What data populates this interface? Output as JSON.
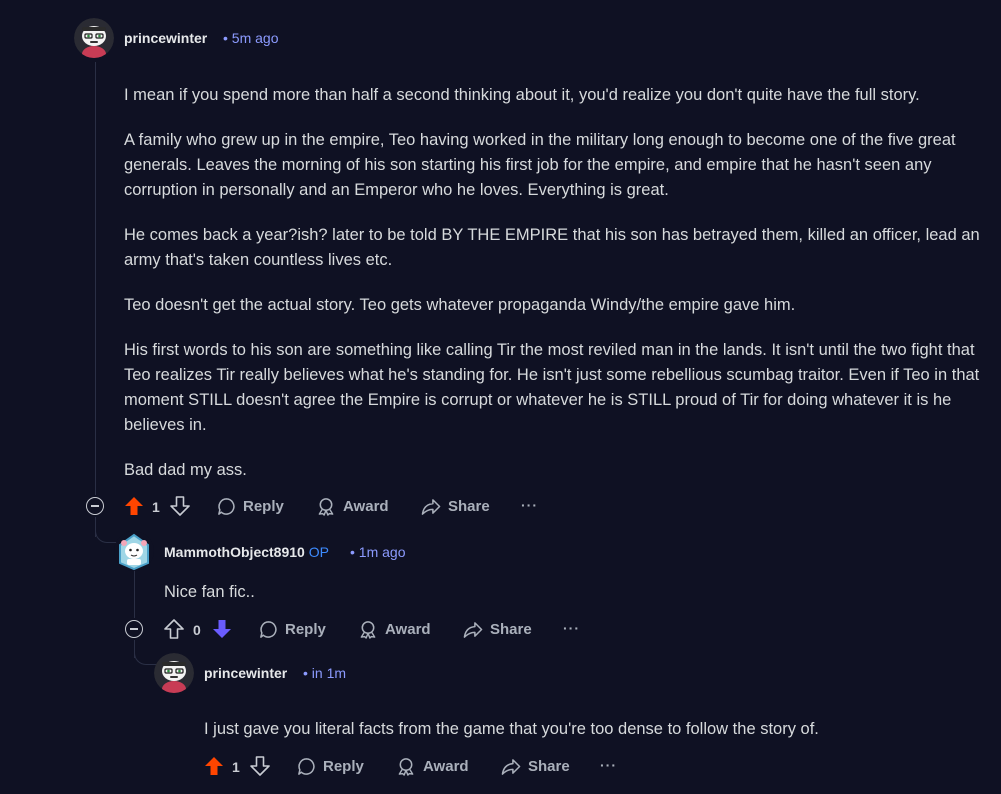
{
  "comments": [
    {
      "username": "princewinter",
      "meta": "• 5m ago",
      "paragraphs": [
        "I mean if you spend more than half a second thinking about it, you'd realize you don't quite have the full story.",
        "A family who grew up in the empire, Teo having worked in the military long enough to become one of the five great generals. Leaves the morning of his son starting his first job for the empire, and empire that he hasn't seen any corruption in personally and an Emperor who he loves. Everything is great.",
        "He comes back a year?ish? later to be told BY THE EMPIRE that his son has betrayed them, killed an officer, lead an army that's taken countless lives etc.",
        "Teo doesn't get the actual story. Teo gets whatever propaganda Windy/the empire gave him.",
        "His first words to his son are something like calling Tir the most reviled man in the lands. It isn't until the two fight that Teo realizes Tir really believes what he's standing for. He isn't just some rebellious scumbag traitor. Even if Teo in that moment STILL doesn't agree the Empire is corrupt or whatever he is STILL proud of Tir for doing whatever it is he believes in.",
        "Bad dad my ass."
      ],
      "score": "1",
      "vote": "up",
      "actions": {
        "reply": "Reply",
        "award": "Award",
        "share": "Share",
        "more": "···"
      }
    },
    {
      "username": "MammothObject8910",
      "op_badge": "OP",
      "meta": "• 1m ago",
      "paragraphs": [
        "Nice fan fic.."
      ],
      "score": "0",
      "vote": "down",
      "actions": {
        "reply": "Reply",
        "award": "Award",
        "share": "Share",
        "more": "···"
      }
    },
    {
      "username": "princewinter",
      "meta": "• in 1m",
      "paragraphs": [
        "I just gave you literal facts from the game that you're too dense to follow the story of."
      ],
      "score": "1",
      "vote": "up",
      "actions": {
        "reply": "Reply",
        "award": "Award",
        "share": "Share",
        "more": "···"
      }
    }
  ],
  "colors": {
    "background": "#0f1123",
    "upvote": "#ff4500",
    "downvote": "#6a5cff",
    "meta": "#8c9bff",
    "op": "#3d8bff"
  },
  "icons": {
    "upvote": "upvote-arrow-icon",
    "downvote": "downvote-arrow-icon",
    "reply": "speech-bubble-icon",
    "award": "award-ribbon-icon",
    "share": "share-arrow-icon",
    "collapse": "collapse-minus-icon"
  }
}
